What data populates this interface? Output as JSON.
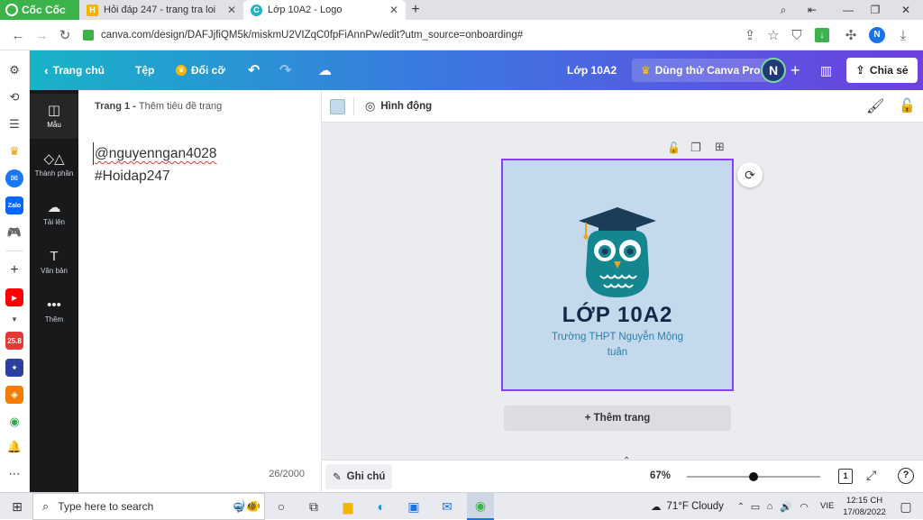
{
  "browser": {
    "brand": "Cốc Cốc",
    "tabs": [
      {
        "title": "Hỏi đáp 247 - trang tra loi",
        "favicon": "H"
      },
      {
        "title": "Lớp 10A2 - Logo",
        "favicon": "C"
      }
    ],
    "new_tab": "+",
    "url": "canva.com/design/DAFJjfiQM5k/miskmU2VIZqC0fpFiAnnPw/edit?utm_source=onboarding#",
    "profile_initial": "N"
  },
  "canva_topbar": {
    "home": "Trang chủ",
    "file": "Tệp",
    "resize": "Đổi cỡ",
    "design_title": "Lớp 10A2",
    "pro_trial": "Dùng thử Canva Pro",
    "avatar_initial": "N",
    "share": "Chia sẻ"
  },
  "rail": [
    {
      "label": "Mẫu",
      "icon": "template-icon"
    },
    {
      "label": "Thành phần",
      "icon": "elements-icon"
    },
    {
      "label": "Tải lên",
      "icon": "upload-icon"
    },
    {
      "label": "Văn bản",
      "icon": "text-icon"
    },
    {
      "label": "Thêm",
      "icon": "more-icon"
    }
  ],
  "notes_panel": {
    "page_label": "Trang 1 - ",
    "page_title_placeholder": "Thêm tiêu đề trang",
    "text_line1": "@nguyenngan4028",
    "text_line2": "#Hoidap247",
    "char_count": "26/2000"
  },
  "editor_toolbar": {
    "color_swatch": "#c5d9ec",
    "animate": "Hình động"
  },
  "design": {
    "title": "LỚP 10A2",
    "subtitle_line1": "Trường THPT Nguyễn Mộng",
    "subtitle_line2": "tuân",
    "background": "#c5d9ec",
    "title_color": "#0e2a47",
    "subtitle_color": "#2a7fa8",
    "owl_color": "#13868f"
  },
  "add_page": "+ Thêm trang",
  "bottombar": {
    "notes": "Ghi chú",
    "zoom": "67%",
    "page_number": "1",
    "help": "?"
  },
  "taskbar": {
    "search_placeholder": "Type here to search",
    "weather": "71°F  Cloudy",
    "language": "VIE",
    "time": "12:15 CH",
    "date": "17/08/2022"
  }
}
